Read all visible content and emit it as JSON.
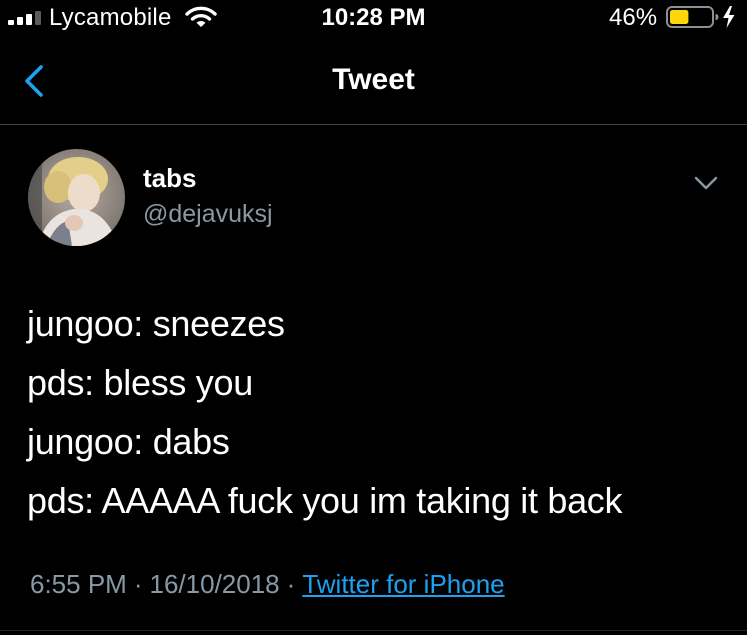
{
  "status_bar": {
    "carrier": "Lycamobile",
    "time": "10:28 PM",
    "battery_percent": "46%",
    "battery_level": 0.46,
    "battery_color": "#ffd60a",
    "charging": true,
    "signal_bars": 3,
    "icons": [
      "signal-icon",
      "wifi-icon",
      "battery-icon",
      "bolt-icon"
    ]
  },
  "nav": {
    "title": "Tweet",
    "back_icon": "chevron-left-icon",
    "accent_color": "#1da1f2"
  },
  "tweet": {
    "author": {
      "display_name": "tabs",
      "handle": "@dejavuksj"
    },
    "lines": [
      "jungoo: sneezes",
      "pds: bless you",
      "jungoo: dabs",
      "pds: AAAAA fuck you im taking it back"
    ],
    "time": "6:55 PM",
    "separator": "·",
    "date": "16/10/2018",
    "source": "Twitter for iPhone",
    "menu_icon": "chevron-down-icon"
  }
}
